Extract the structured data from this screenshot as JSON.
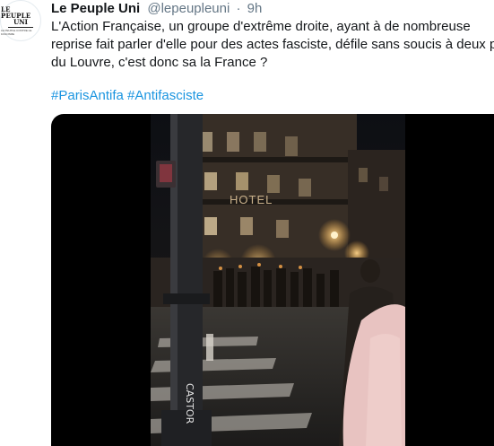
{
  "tweet": {
    "avatar_text": {
      "line1": "LE PEUPLE",
      "line2": "UNI",
      "line3": "LE PEUPLE CONTRE LE FASCISME"
    },
    "author_name": "Le Peuple Uni",
    "author_handle": "@lepeupleuni",
    "separator": "·",
    "time": "9h",
    "text_lines": [
      "L'Action Française, un groupe d'extrême droite, ayant à de nombreuse",
      "reprise fait parler d'elle pour des actes fasciste, défile sans soucis à deux pas",
      "du Louvre, c'est donc sa la France ?"
    ],
    "hashtags": [
      "#ParisAntifa",
      "#Antifasciste"
    ]
  },
  "media": {
    "type": "video",
    "scene_text": {
      "hotel_sign": "HOTEL",
      "graffiti": "CASTOR"
    }
  },
  "colors": {
    "link": "#1b95e0",
    "text": "#14171a",
    "secondary": "#657786",
    "media_background": "#000000"
  }
}
